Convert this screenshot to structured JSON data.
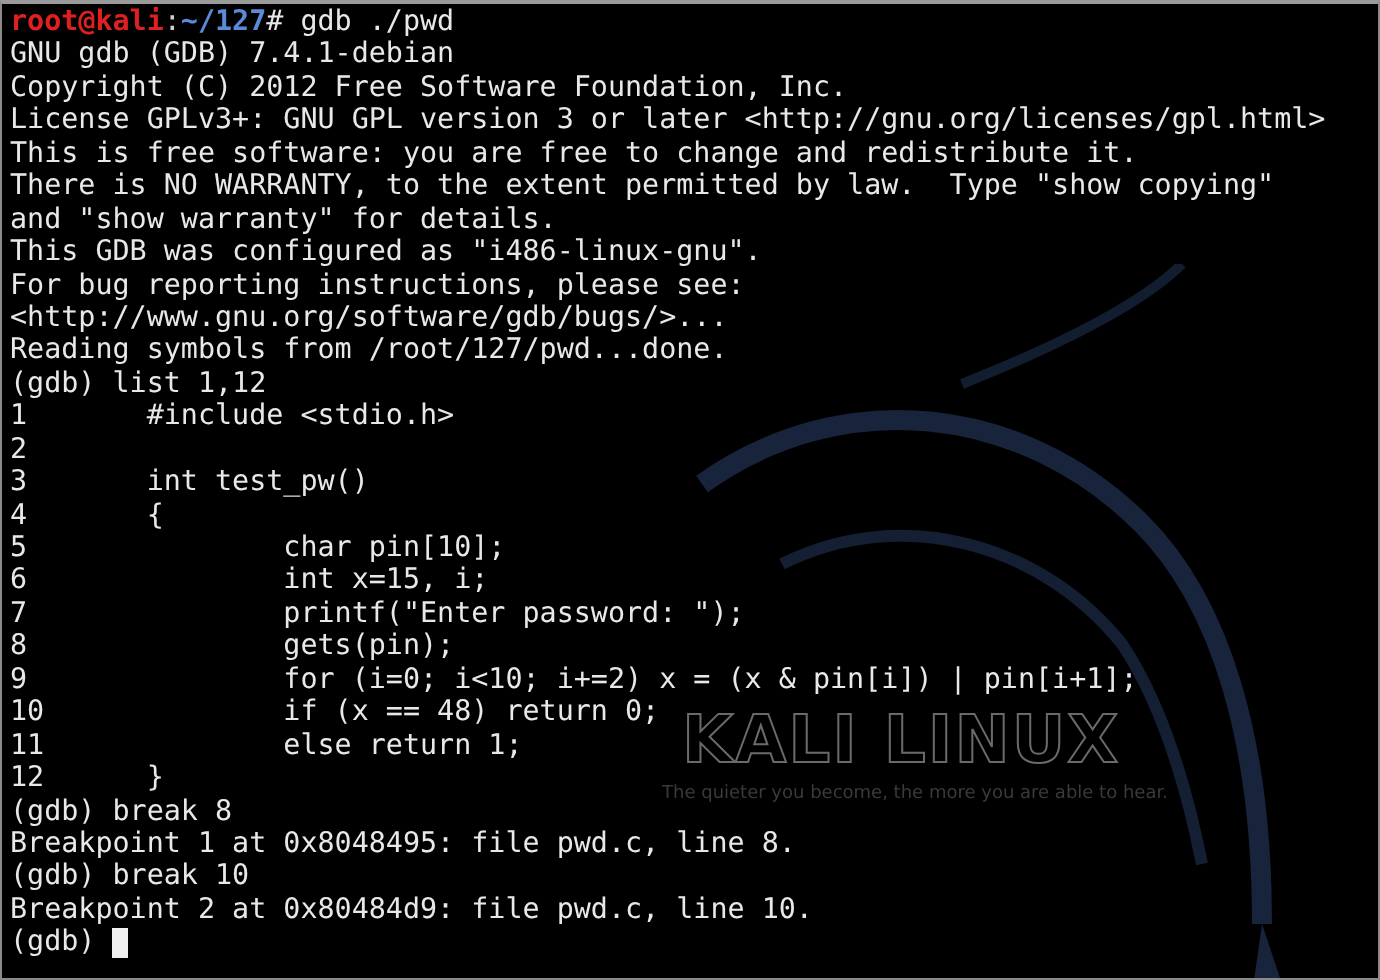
{
  "terminal": {
    "wallpaper": {
      "logo": "KALI LINUX",
      "tagline": "The quieter you become, the more you are able to hear."
    },
    "lines": [
      {
        "kind": "shell",
        "user": "root@kali",
        "separator": ":",
        "path": "~/127",
        "symbol": "#",
        "command": " gdb ./pwd"
      },
      {
        "kind": "output",
        "text": "GNU gdb (GDB) 7.4.1-debian"
      },
      {
        "kind": "output",
        "text": "Copyright (C) 2012 Free Software Foundation, Inc."
      },
      {
        "kind": "output",
        "text": "License GPLv3+: GNU GPL version 3 or later <http://gnu.org/licenses/gpl.html>"
      },
      {
        "kind": "output",
        "text": "This is free software: you are free to change and redistribute it."
      },
      {
        "kind": "output",
        "text": "There is NO WARRANTY, to the extent permitted by law.  Type \"show copying\""
      },
      {
        "kind": "output",
        "text": "and \"show warranty\" for details."
      },
      {
        "kind": "output",
        "text": "This GDB was configured as \"i486-linux-gnu\"."
      },
      {
        "kind": "output",
        "text": "For bug reporting instructions, please see:"
      },
      {
        "kind": "output",
        "text": "<http://www.gnu.org/software/gdb/bugs/>..."
      },
      {
        "kind": "output",
        "text": "Reading symbols from /root/127/pwd...done."
      },
      {
        "kind": "gdb",
        "text": "(gdb) list 1,12"
      },
      {
        "kind": "source",
        "text": "1       #include <stdio.h>"
      },
      {
        "kind": "source",
        "text": "2"
      },
      {
        "kind": "source",
        "text": "3       int test_pw()"
      },
      {
        "kind": "source",
        "text": "4       {"
      },
      {
        "kind": "source",
        "text": "5               char pin[10];"
      },
      {
        "kind": "source",
        "text": "6               int x=15, i;"
      },
      {
        "kind": "source",
        "text": "7               printf(\"Enter password: \");"
      },
      {
        "kind": "source",
        "text": "8               gets(pin);"
      },
      {
        "kind": "source",
        "text": "9               for (i=0; i<10; i+=2) x = (x & pin[i]) | pin[i+1];"
      },
      {
        "kind": "source",
        "text": "10              if (x == 48) return 0;"
      },
      {
        "kind": "source",
        "text": "11              else return 1;"
      },
      {
        "kind": "source",
        "text": "12      }"
      },
      {
        "kind": "gdb",
        "text": "(gdb) break 8"
      },
      {
        "kind": "output",
        "text": "Breakpoint 1 at 0x8048495: file pwd.c, line 8."
      },
      {
        "kind": "gdb",
        "text": "(gdb) break 10"
      },
      {
        "kind": "output",
        "text": "Breakpoint 2 at 0x80484d9: file pwd.c, line 10."
      },
      {
        "kind": "input",
        "text": "(gdb)",
        "cursor": true
      }
    ]
  }
}
